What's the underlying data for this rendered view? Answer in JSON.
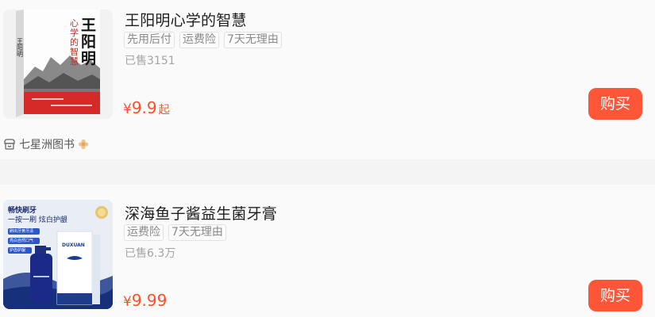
{
  "products": [
    {
      "title": "王阳明心学的智慧",
      "tags": [
        "先用后付",
        "运费险",
        "7天无理由"
      ],
      "sold": "已售3151",
      "price_symbol": "¥",
      "price": "9.9",
      "price_suffix": "起",
      "buy_label": "购买",
      "shop_name": "七星洲图书",
      "image": {
        "title": "王阳明",
        "subtitle": "心学的智慧"
      }
    },
    {
      "title": "深海鱼子酱益生菌牙膏",
      "tags": [
        "运费险",
        "7天无理由"
      ],
      "sold": "已售6.3万",
      "price_symbol": "¥",
      "price": "9.99",
      "buy_label": "购买",
      "image": {
        "headline": "畅快刷牙",
        "slogan": "一按一刷 炫白护龈",
        "features": [
          "刷出牙黄牙渍",
          "亮白自然口气",
          "护齿护龈"
        ],
        "brand": "DUXUAN"
      }
    }
  ],
  "colors": {
    "price": "#ff4e2a",
    "buy_button": "#ff5638",
    "card_bg": "#fafafa",
    "page_bg": "#f4f4f4"
  },
  "icons": {
    "shop_icon": "shop-icon",
    "shop_badge": "flower-badge-icon"
  }
}
